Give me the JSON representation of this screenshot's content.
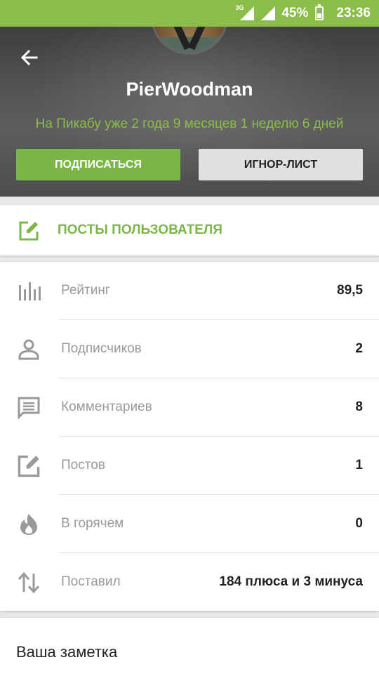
{
  "status_bar": {
    "network": "3G",
    "battery_percent": "45%",
    "battery_level": 0.45,
    "time": "23:36"
  },
  "profile": {
    "username": "PierWoodman",
    "member_since": "На Пикабу уже 2 года 9 месяцев 1 неделю 6 дней",
    "subscribe_label": "ПОДПИСАТЬСЯ",
    "ignore_label": "ИГНОР-ЛИСТ"
  },
  "posts_link": {
    "label": "ПОСТЫ ПОЛЬЗОВАТЕЛЯ",
    "icon": "edit-icon"
  },
  "stats": [
    {
      "label": "Рейтинг",
      "value": "89,5",
      "icon": "bar-chart-icon"
    },
    {
      "label": "Подписчиков",
      "value": "2",
      "icon": "person-icon"
    },
    {
      "label": "Комментариев",
      "value": "8",
      "icon": "comment-icon"
    },
    {
      "label": "Постов",
      "value": "1",
      "icon": "edit-icon"
    },
    {
      "label": "В горячем",
      "value": "0",
      "icon": "flame-icon"
    },
    {
      "label": "Поставил",
      "value": "184 плюса и 3 минуса",
      "icon": "swap-vertical-icon"
    }
  ],
  "note": {
    "title": "Ваша заметка"
  },
  "colors": {
    "accent": "#7ab648",
    "status_bar": "#8bbd4a"
  }
}
